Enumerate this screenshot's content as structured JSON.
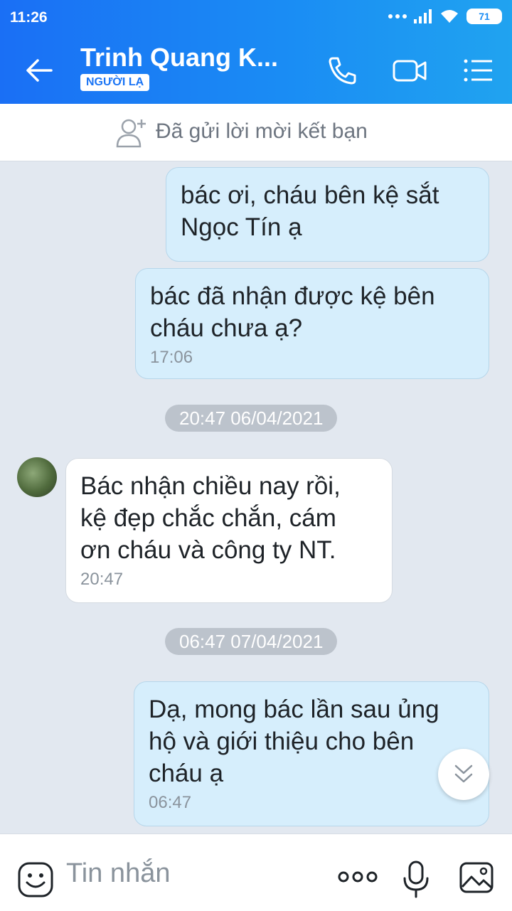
{
  "status_bar": {
    "time": "11:26",
    "battery": "71"
  },
  "header": {
    "contact_name": "Trinh Quang K...",
    "badge": "NGƯỜI LẠ"
  },
  "friend_request": {
    "text": "Đã gửi lời mời kết bạn"
  },
  "messages": [
    {
      "side": "sent",
      "text_lines": [
        "bác ơi, cháu bên kệ sắt",
        "Ngọc Tín ạ"
      ],
      "time": ""
    },
    {
      "side": "sent",
      "text_lines": [
        "bác đã nhận được kệ bên",
        "cháu chưa ạ?"
      ],
      "time": "17:06"
    },
    {
      "side": "date",
      "text": "20:47 06/04/2021"
    },
    {
      "side": "received",
      "text_lines": [
        "Bác nhận chiều nay rồi,",
        "kệ đẹp chắc chắn, cám",
        "ơn cháu và công ty NT."
      ],
      "time": "20:47"
    },
    {
      "side": "date",
      "text": "06:47 07/04/2021"
    },
    {
      "side": "sent",
      "text_lines": [
        "Dạ, mong bác lần sau ủng",
        "hộ và giới thiệu cho bên",
        "cháu ạ"
      ],
      "time": "06:47"
    }
  ],
  "composer": {
    "placeholder": "Tin nhắn"
  },
  "icons": {
    "back": "back-arrow-icon",
    "call": "phone-icon",
    "video": "video-camera-icon",
    "menu": "list-menu-icon",
    "add_friend": "add-user-icon",
    "emoji": "emoji-icon",
    "more": "more-dots-icon",
    "mic": "microphone-icon",
    "image": "image-icon",
    "scroll": "chevron-double-down-icon"
  },
  "colors": {
    "accent": "#1a8cf4",
    "sent_bubble": "#d6eefc",
    "background": "#e2e8f0"
  }
}
